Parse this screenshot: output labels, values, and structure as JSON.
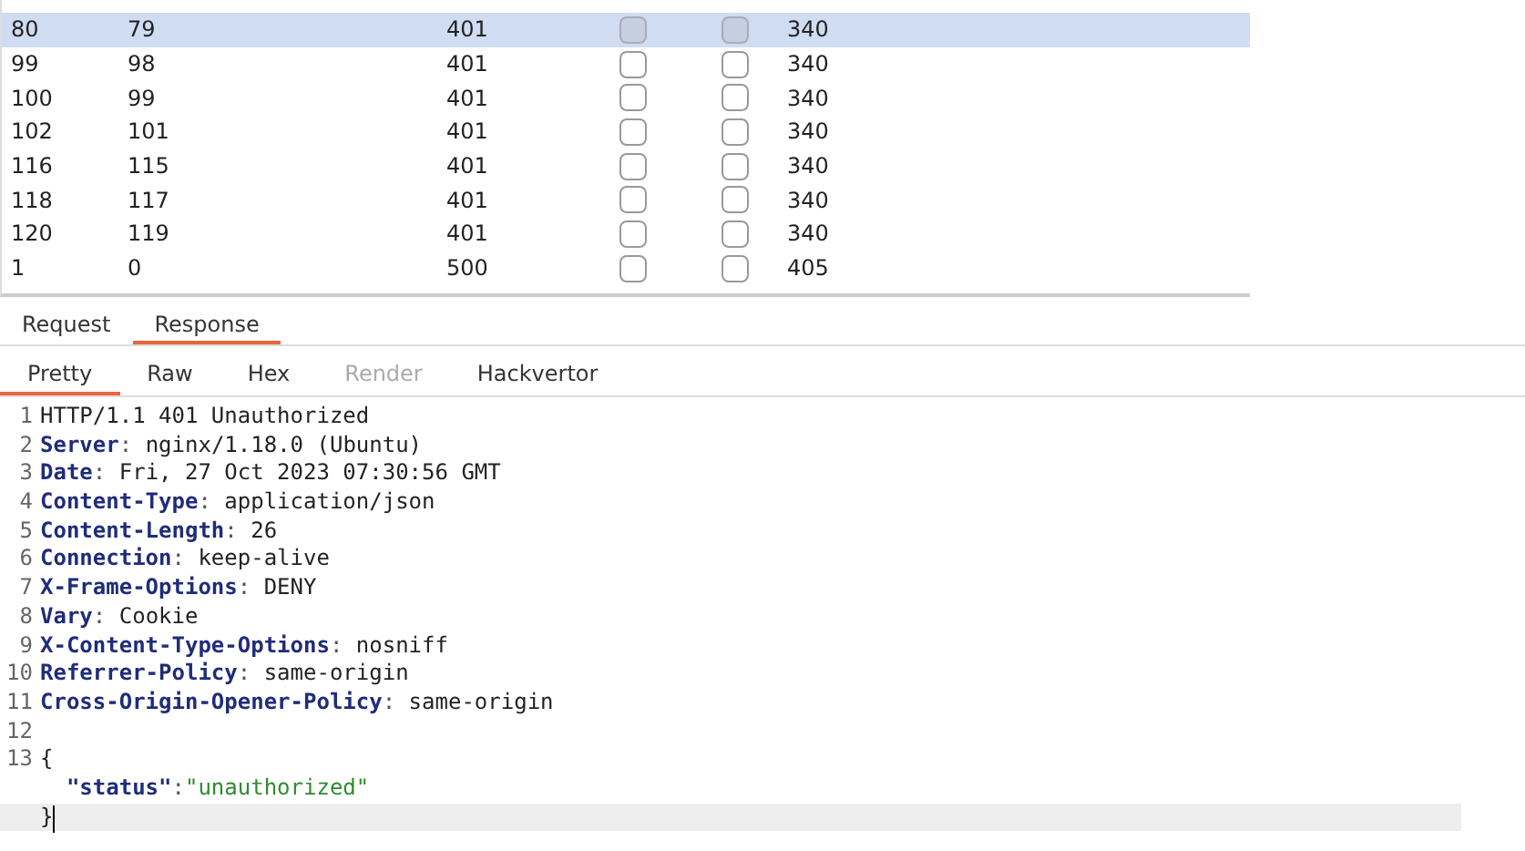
{
  "table": {
    "rows": [
      {
        "cells": [
          "80",
          "79",
          "401",
          "340"
        ],
        "check_1": false,
        "check_2": false,
        "selected": true
      },
      {
        "cells": [
          "99",
          "98",
          "401",
          "340"
        ],
        "check_1": false,
        "check_2": false,
        "selected": false
      },
      {
        "cells": [
          "100",
          "99",
          "401",
          "340"
        ],
        "check_1": false,
        "check_2": false,
        "selected": false
      },
      {
        "cells": [
          "102",
          "101",
          "401",
          "340"
        ],
        "check_1": false,
        "check_2": false,
        "selected": false
      },
      {
        "cells": [
          "116",
          "115",
          "401",
          "340"
        ],
        "check_1": false,
        "check_2": false,
        "selected": false
      },
      {
        "cells": [
          "118",
          "117",
          "401",
          "340"
        ],
        "check_1": false,
        "check_2": false,
        "selected": false
      },
      {
        "cells": [
          "120",
          "119",
          "401",
          "340"
        ],
        "check_1": false,
        "check_2": false,
        "selected": false
      },
      {
        "cells": [
          "1",
          "0",
          "500",
          "405"
        ],
        "check_1": false,
        "check_2": false,
        "selected": false
      }
    ]
  },
  "message_tabs": [
    {
      "label": "Request",
      "selected": false
    },
    {
      "label": "Response",
      "selected": true
    }
  ],
  "view_tabs": [
    {
      "label": "Pretty",
      "selected": true,
      "disabled": false
    },
    {
      "label": "Raw",
      "selected": false,
      "disabled": false
    },
    {
      "label": "Hex",
      "selected": false,
      "disabled": false
    },
    {
      "label": "Render",
      "selected": false,
      "disabled": true
    },
    {
      "label": "Hackvertor",
      "selected": false,
      "disabled": false
    }
  ],
  "editor": {
    "lines": [
      {
        "number": "1",
        "kind": "plain",
        "text": "HTTP/1.1 401 Unauthorized"
      },
      {
        "number": "2",
        "kind": "header",
        "name": "Server",
        "separator": ":",
        "value": "nginx/1.18.0 (Ubuntu)"
      },
      {
        "number": "3",
        "kind": "header",
        "name": "Date",
        "separator": ":",
        "value": "Fri, 27 Oct 2023 07:30:56 GMT"
      },
      {
        "number": "4",
        "kind": "header",
        "name": "Content-Type",
        "separator": ":",
        "value": "application/json"
      },
      {
        "number": "5",
        "kind": "header",
        "name": "Content-Length",
        "separator": ":",
        "value": "26"
      },
      {
        "number": "6",
        "kind": "header",
        "name": "Connection",
        "separator": ":",
        "value": "keep-alive"
      },
      {
        "number": "7",
        "kind": "header",
        "name": "X-Frame-Options",
        "separator": ":",
        "value": "DENY"
      },
      {
        "number": "8",
        "kind": "header",
        "name": "Vary",
        "separator": ":",
        "value": "Cookie"
      },
      {
        "number": "9",
        "kind": "header",
        "name": "X-Content-Type-Options",
        "separator": ":",
        "value": "nosniff"
      },
      {
        "number": "10",
        "kind": "header",
        "name": "Referrer-Policy",
        "separator": ":",
        "value": "same-origin"
      },
      {
        "number": "11",
        "kind": "header",
        "name": "Cross-Origin-Opener-Policy",
        "separator": ":",
        "value": "same-origin"
      },
      {
        "number": "12",
        "kind": "plain"
      },
      {
        "number": "13",
        "kind": "plain",
        "text": "{"
      },
      {
        "kind": "json",
        "key": "\"status\"",
        "separator": ":",
        "value": "\"unauthorized\""
      },
      {
        "kind": "plain",
        "text": "}",
        "current": true
      }
    ]
  }
}
